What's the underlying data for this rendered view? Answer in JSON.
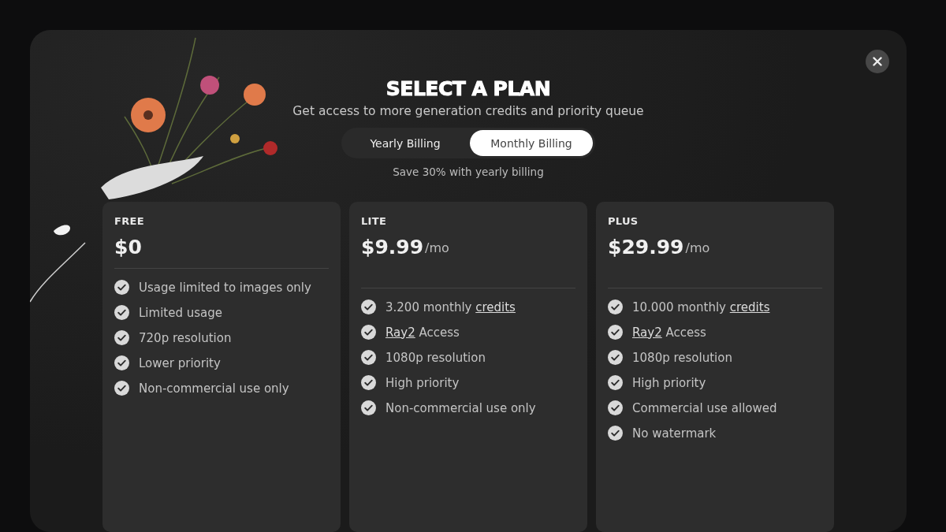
{
  "title": "SELECT A PLAN",
  "subtitle": "Get access to more generation credits and priority queue",
  "billing_toggle": [
    {
      "label": "Yearly Billing",
      "selected": false
    },
    {
      "label": "Monthly Billing",
      "selected": true
    }
  ],
  "billing_note": "Save 30% with yearly billing",
  "plans": [
    {
      "name": "FREE",
      "price": "$0",
      "features": [
        [
          {
            "text": "Usage limited to images only"
          }
        ],
        [
          {
            "text": "Limited usage"
          }
        ],
        [
          {
            "text": "720p resolution"
          }
        ],
        [
          {
            "text": "Lower priority"
          }
        ],
        [
          {
            "text": "Non-commercial use only"
          }
        ]
      ]
    },
    {
      "name": "LITE",
      "price": "$9.99",
      "period": "/mo",
      "features": [
        [
          {
            "text": "3.200 monthly "
          },
          {
            "text": "credits",
            "link": true
          }
        ],
        [
          {
            "text": "Ray2",
            "link": true
          },
          {
            "text": " Access"
          }
        ],
        [
          {
            "text": "1080p resolution"
          }
        ],
        [
          {
            "text": "High priority"
          }
        ],
        [
          {
            "text": "Non-commercial use only"
          }
        ]
      ]
    },
    {
      "name": "PLUS",
      "price": "$29.99",
      "period": "/mo",
      "features": [
        [
          {
            "text": "10.000 monthly "
          },
          {
            "text": "credits",
            "link": true
          }
        ],
        [
          {
            "text": "Ray2",
            "link": true
          },
          {
            "text": " Access"
          }
        ],
        [
          {
            "text": "1080p resolution"
          }
        ],
        [
          {
            "text": "High priority"
          }
        ],
        [
          {
            "text": "Commercial use allowed"
          }
        ],
        [
          {
            "text": "No watermark"
          }
        ]
      ]
    }
  ]
}
